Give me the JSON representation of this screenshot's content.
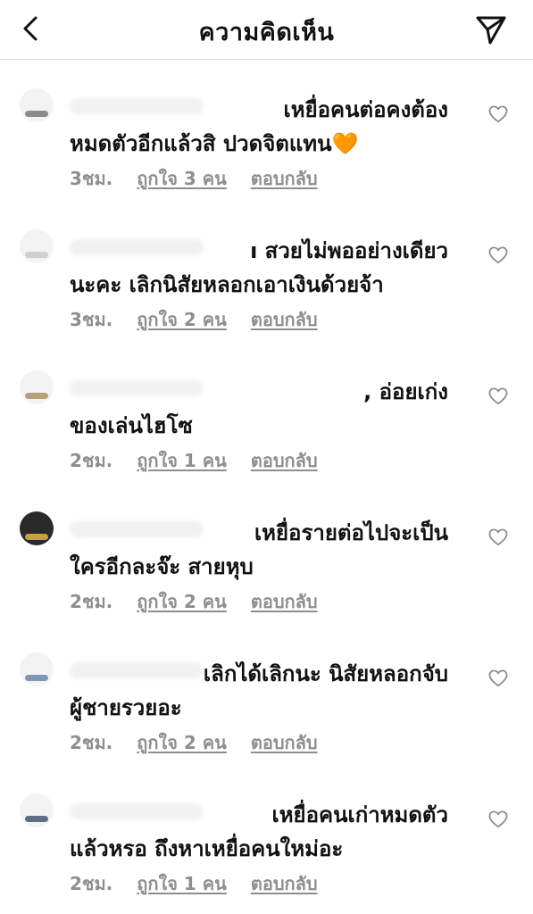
{
  "header": {
    "title": "ความคิดเห็น",
    "back_icon": "chevron-left-icon",
    "send_icon": "send-icon"
  },
  "comments": [
    {
      "line1": "เหยื่อคนต่อคงต้อง",
      "line2": "หมดตัวอีกแล้วสิ ปวดจิตแทน",
      "emoji": "🧡",
      "time": "3ชม.",
      "likes": "ถูกใจ 3 คน",
      "reply": "ตอบกลับ"
    },
    {
      "line1": "ı สวยไม่พออย่างเดียว",
      "line2": "นะคะ เลิกนิสัยหลอกเอาเงินด้วยจ้า",
      "emoji": "",
      "time": "3ชม.",
      "likes": "ถูกใจ 2 คน",
      "reply": "ตอบกลับ"
    },
    {
      "line1": ", อ่อยเก่ง",
      "line2": "ของเล่นไฮโซ",
      "emoji": "",
      "time": "2ชม.",
      "likes": "ถูกใจ 1 คน",
      "reply": "ตอบกลับ"
    },
    {
      "line1": "เหยื่อรายต่อไปจะเป็น",
      "line2": "ใครอีกละจ๊ะ สายหุบ",
      "emoji": "",
      "time": "2ชม.",
      "likes": "ถูกใจ 2 คน",
      "reply": "ตอบกลับ"
    },
    {
      "line1": "เลิกได้เลิกนะ นิสัยหลอกจับ",
      "line2": "ผู้ชายรวยอะ",
      "emoji": "",
      "time": "2ชม.",
      "likes": "ถูกใจ 2 คน",
      "reply": "ตอบกลับ"
    },
    {
      "line1": "เหยื่อคนเก่าหมดตัว",
      "line2": "แล้วหรอ ถึงหาเหยื่อคนใหม่อะ",
      "emoji": "",
      "time": "2ชม.",
      "likes": "ถูกใจ 1 คน",
      "reply": "ตอบกลับ"
    }
  ]
}
